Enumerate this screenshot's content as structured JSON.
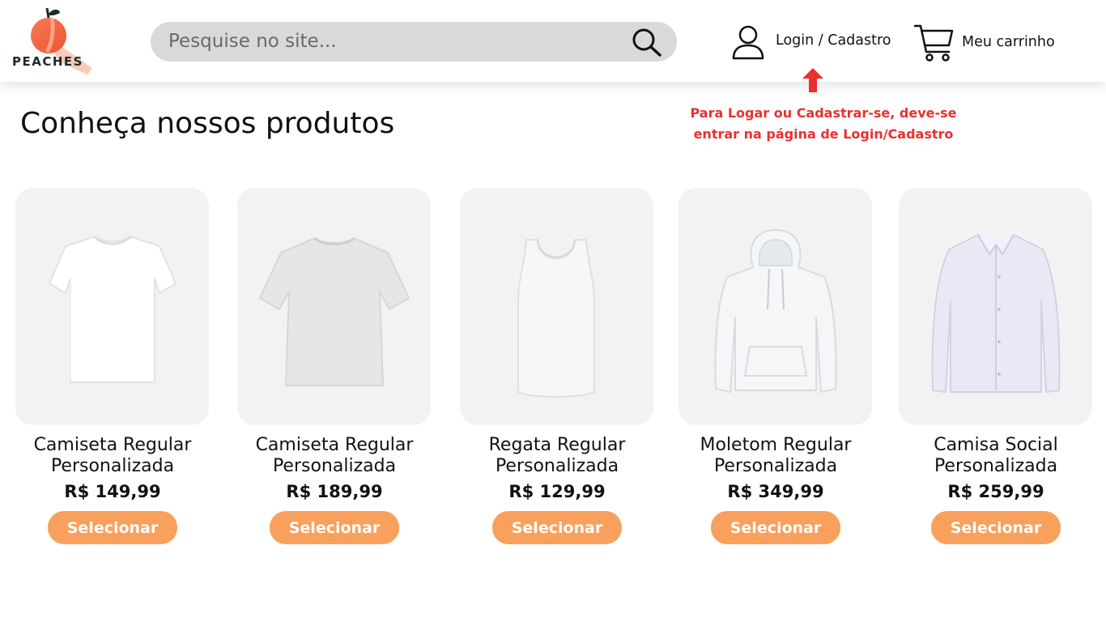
{
  "brand": {
    "name": "PEACHES",
    "accent": "#f8a05c",
    "logo_colors": [
      "#f5734a",
      "#1d2b2b"
    ]
  },
  "header": {
    "search": {
      "placeholder": "Pesquise no site...",
      "value": "",
      "icon": "search-icon"
    },
    "login": {
      "label": "Login / Cadastro",
      "icon": "user-icon"
    },
    "cart": {
      "label": "Meu carrinho",
      "icon": "cart-icon"
    }
  },
  "annotation": {
    "text": "Para Logar ou Cadastrar-se, deve-se entrar na página de Login/Cadastro",
    "icon": "arrow-up-icon",
    "color": "#e8312f"
  },
  "main": {
    "title": "Conheça nossos produtos",
    "products": [
      {
        "name": "Camiseta Regular Personalizada",
        "price": "R$ 149,99",
        "button": "Selecionar",
        "image": "tshirt-icon"
      },
      {
        "name": "Camiseta Regular Personalizada",
        "price": "R$ 189,99",
        "button": "Selecionar",
        "image": "oversized-tshirt-icon"
      },
      {
        "name": "Regata Regular Personalizada",
        "price": "R$ 129,99",
        "button": "Selecionar",
        "image": "tank-top-icon"
      },
      {
        "name": "Moletom Regular Personalizada",
        "price": "R$ 349,99",
        "button": "Selecionar",
        "image": "hoodie-icon"
      },
      {
        "name": "Camisa Social Personalizada",
        "price": "R$ 259,99",
        "button": "Selecionar",
        "image": "dress-shirt-icon"
      }
    ]
  }
}
